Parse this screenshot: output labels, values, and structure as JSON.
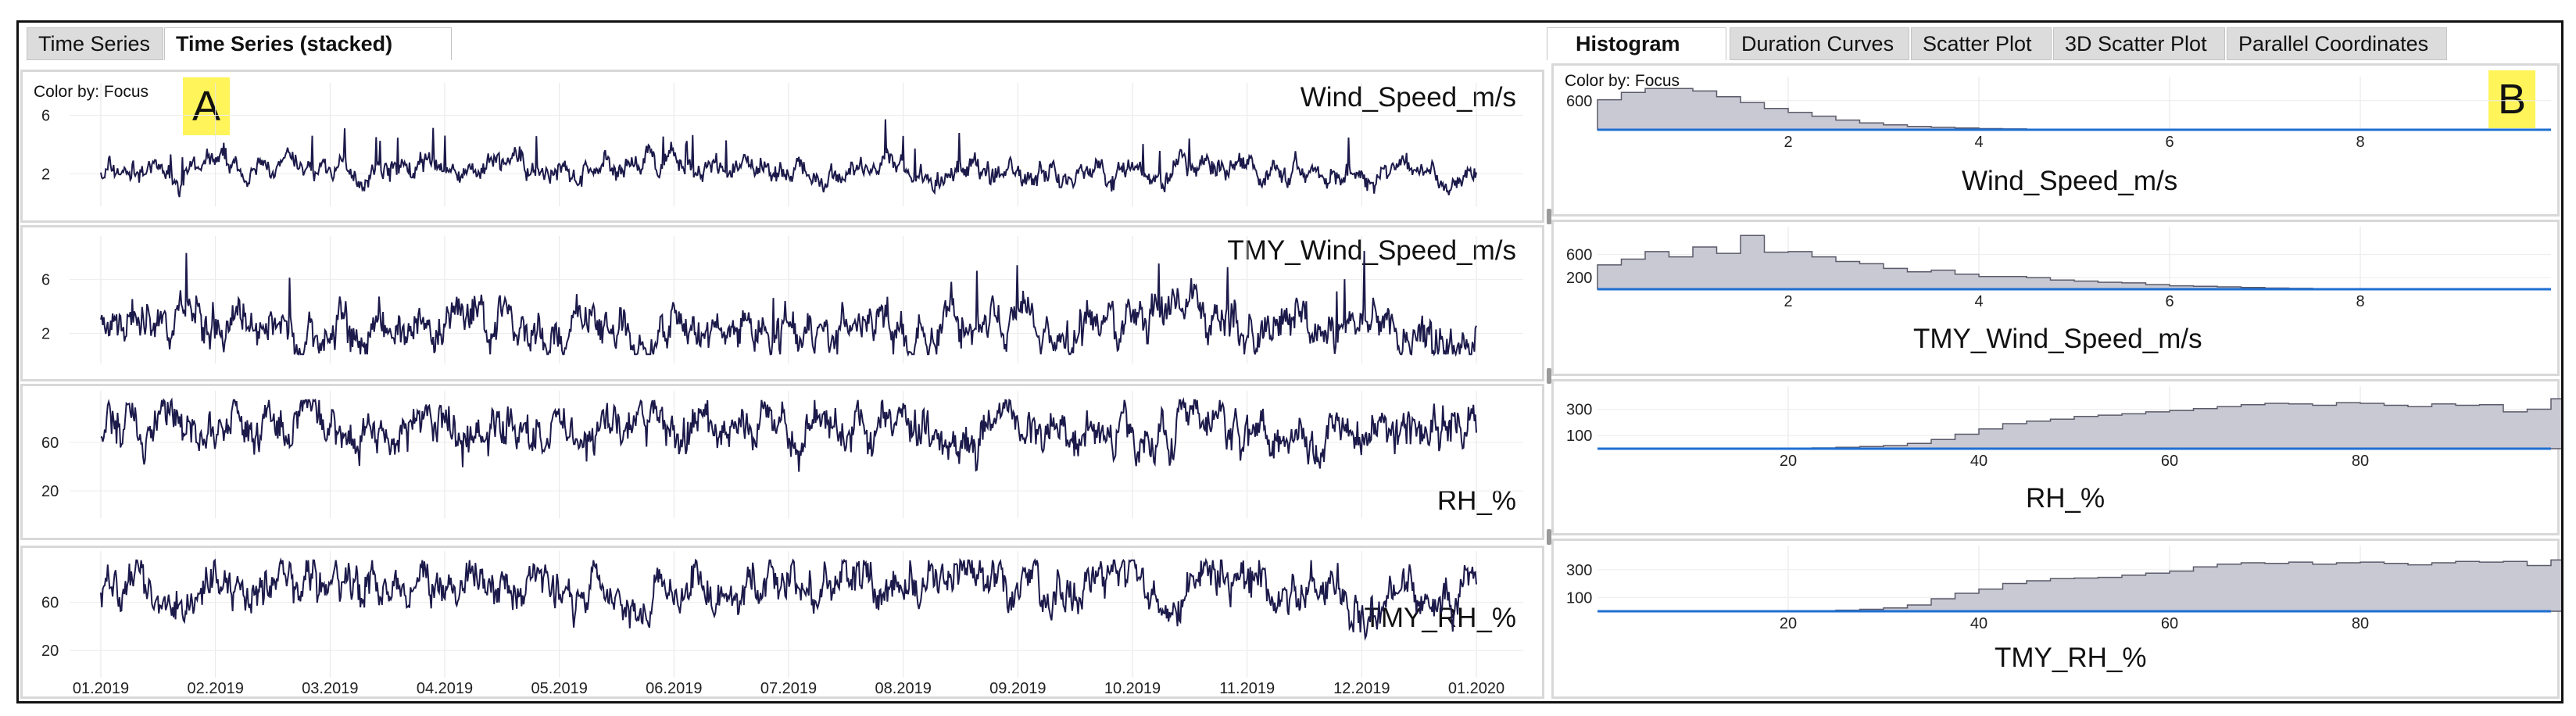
{
  "left": {
    "tabs": [
      {
        "label": "Time Series",
        "active": false
      },
      {
        "label": "Time Series (stacked)",
        "active": true
      }
    ],
    "color_by": "Color by: Focus",
    "badge": "A",
    "x_ticks": [
      "01.2019",
      "02.2019",
      "03.2019",
      "04.2019",
      "05.2019",
      "06.2019",
      "07.2019",
      "08.2019",
      "09.2019",
      "10.2019",
      "11.2019",
      "12.2019",
      "01.2020"
    ]
  },
  "right": {
    "tabs": [
      {
        "label": "Histogram",
        "active": true
      },
      {
        "label": "Duration Curves",
        "active": false
      },
      {
        "label": "Scatter Plot",
        "active": false
      },
      {
        "label": "3D Scatter Plot",
        "active": false
      },
      {
        "label": "Parallel Coordinates",
        "active": false
      }
    ],
    "color_by": "Color by: Focus",
    "badge": "B"
  },
  "colors": {
    "line": "#1c1a4a",
    "hist_fill": "#c9c9d3",
    "hist_stroke": "#5a5a6a",
    "axis_blue": "#1f6fd1",
    "badge": "#fff45a"
  },
  "chart_data": [
    {
      "type": "line",
      "title": "Wind_Speed_m/s",
      "y_ticks": [
        "6",
        "2"
      ],
      "ylim": [
        0,
        8
      ],
      "mean": 2.2,
      "spread": 0.8,
      "x": [
        "01.2019",
        "01.2020"
      ]
    },
    {
      "type": "line",
      "title": "TMY_Wind_Speed_m/s",
      "y_ticks": [
        "6",
        "2"
      ],
      "ylim": [
        0,
        9
      ],
      "mean": 2.6,
      "spread": 1.6,
      "x": [
        "01.2019",
        "01.2020"
      ]
    },
    {
      "type": "line",
      "title": "RH_%",
      "y_ticks": [
        "60",
        "20"
      ],
      "ylim": [
        0,
        100
      ],
      "mean": 72,
      "spread": 18,
      "x": [
        "01.2019",
        "01.2020"
      ]
    },
    {
      "type": "line",
      "title": "TMY_RH_%",
      "y_ticks": [
        "60",
        "20"
      ],
      "ylim": [
        0,
        100
      ],
      "mean": 72,
      "spread": 18,
      "x": [
        "01.2019",
        "01.2020"
      ]
    },
    {
      "type": "bar",
      "title": "Wind_Speed_m/s",
      "x_ticks": [
        "2",
        "4",
        "6",
        "8"
      ],
      "y_ticks": [
        "600"
      ],
      "xlim": [
        0,
        10
      ],
      "ylim": [
        0,
        1000
      ],
      "bins_start": 0,
      "bin_width": 0.25,
      "values": [
        620,
        770,
        850,
        850,
        800,
        680,
        560,
        440,
        360,
        280,
        200,
        140,
        100,
        70,
        50,
        35,
        25,
        18,
        12,
        8,
        6,
        4,
        3,
        2,
        2,
        1,
        1,
        1,
        1,
        0,
        0,
        0,
        0,
        0,
        0,
        0,
        0,
        0,
        0,
        0
      ]
    },
    {
      "type": "bar",
      "title": "TMY_Wind_Speed_m/s",
      "x_ticks": [
        "2",
        "4",
        "6",
        "8"
      ],
      "y_ticks": [
        "600",
        "200"
      ],
      "xlim": [
        0,
        10
      ],
      "ylim": [
        0,
        1000
      ],
      "bins_start": 0,
      "bin_width": 0.25,
      "values": [
        420,
        520,
        650,
        560,
        730,
        620,
        930,
        640,
        650,
        560,
        480,
        440,
        360,
        300,
        330,
        260,
        220,
        220,
        200,
        160,
        140,
        120,
        110,
        80,
        60,
        50,
        40,
        30,
        20,
        15,
        10,
        8,
        6,
        5,
        4,
        3,
        2,
        1,
        1,
        0
      ]
    },
    {
      "type": "bar",
      "title": "RH_%",
      "x_ticks": [
        "20",
        "40",
        "60",
        "80"
      ],
      "y_ticks": [
        "300",
        "100"
      ],
      "xlim": [
        0,
        100
      ],
      "ylim": [
        0,
        440
      ],
      "bins_start": 0,
      "bin_width": 2.5,
      "values": [
        0,
        0,
        0,
        0,
        0,
        0,
        1,
        2,
        4,
        6,
        10,
        16,
        24,
        40,
        70,
        110,
        150,
        190,
        210,
        225,
        245,
        255,
        265,
        280,
        290,
        305,
        320,
        335,
        345,
        340,
        330,
        350,
        345,
        330,
        320,
        340,
        330,
        335,
        280,
        300,
        380,
        320,
        270,
        230,
        180,
        120,
        60,
        20
      ]
    },
    {
      "type": "bar",
      "title": "TMY_RH_%",
      "x_ticks": [
        "20",
        "40",
        "60",
        "80"
      ],
      "y_ticks": [
        "300",
        "100"
      ],
      "xlim": [
        0,
        100
      ],
      "ylim": [
        0,
        440
      ],
      "bins_start": 0,
      "bin_width": 2.5,
      "values": [
        0,
        0,
        0,
        0,
        0,
        0,
        0,
        1,
        2,
        4,
        8,
        14,
        24,
        45,
        90,
        130,
        160,
        200,
        220,
        235,
        240,
        245,
        260,
        275,
        290,
        320,
        340,
        350,
        345,
        355,
        340,
        350,
        355,
        345,
        335,
        350,
        360,
        355,
        360,
        330,
        370,
        400,
        430,
        410,
        120,
        30
      ]
    }
  ]
}
